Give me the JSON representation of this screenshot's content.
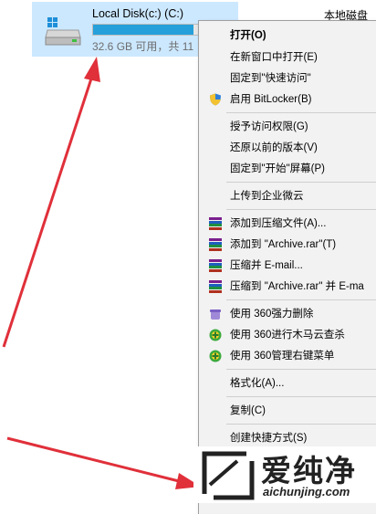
{
  "drive": {
    "name": "Local Disk(c:) (C:)",
    "free_text": "32.6 GB 可用，共 11",
    "type": "本地磁盘",
    "used_fraction": 0.74,
    "icon": "hard-drive-icon"
  },
  "menu": {
    "items": [
      {
        "label": "打开(O)",
        "bold": true
      },
      {
        "label": "在新窗口中打开(E)"
      },
      {
        "label": "固定到\"快速访问\""
      },
      {
        "label": "启用 BitLocker(B)",
        "icon": "shield-icon"
      },
      {
        "label": "授予访问权限(G)"
      },
      {
        "label": "还原以前的版本(V)"
      },
      {
        "label": "固定到\"开始\"屏幕(P)"
      },
      {
        "label": "上传到企业微云"
      },
      {
        "label": "添加到压缩文件(A)...",
        "icon": "winrar-icon"
      },
      {
        "label": "添加到 \"Archive.rar\"(T)",
        "icon": "winrar-icon"
      },
      {
        "label": "压缩并 E-mail...",
        "icon": "winrar-icon"
      },
      {
        "label": "压缩到 \"Archive.rar\" 并 E-ma",
        "icon": "winrar-icon"
      },
      {
        "label": "使用 360强力删除",
        "icon": "360-delete-icon"
      },
      {
        "label": "使用 360进行木马云查杀",
        "icon": "360-scan-icon"
      },
      {
        "label": "使用 360管理右键菜单",
        "icon": "360-menu-icon"
      },
      {
        "label": "格式化(A)..."
      },
      {
        "label": "复制(C)"
      },
      {
        "label": "创建快捷方式(S)"
      }
    ]
  },
  "watermark": {
    "title": "爱纯净",
    "url": "aichunjing.com"
  },
  "colors": {
    "selection": "#cce8ff",
    "bar_fill": "#26a0da",
    "arrow": "#e0303a",
    "menu_bg": "#f2f2f2"
  }
}
